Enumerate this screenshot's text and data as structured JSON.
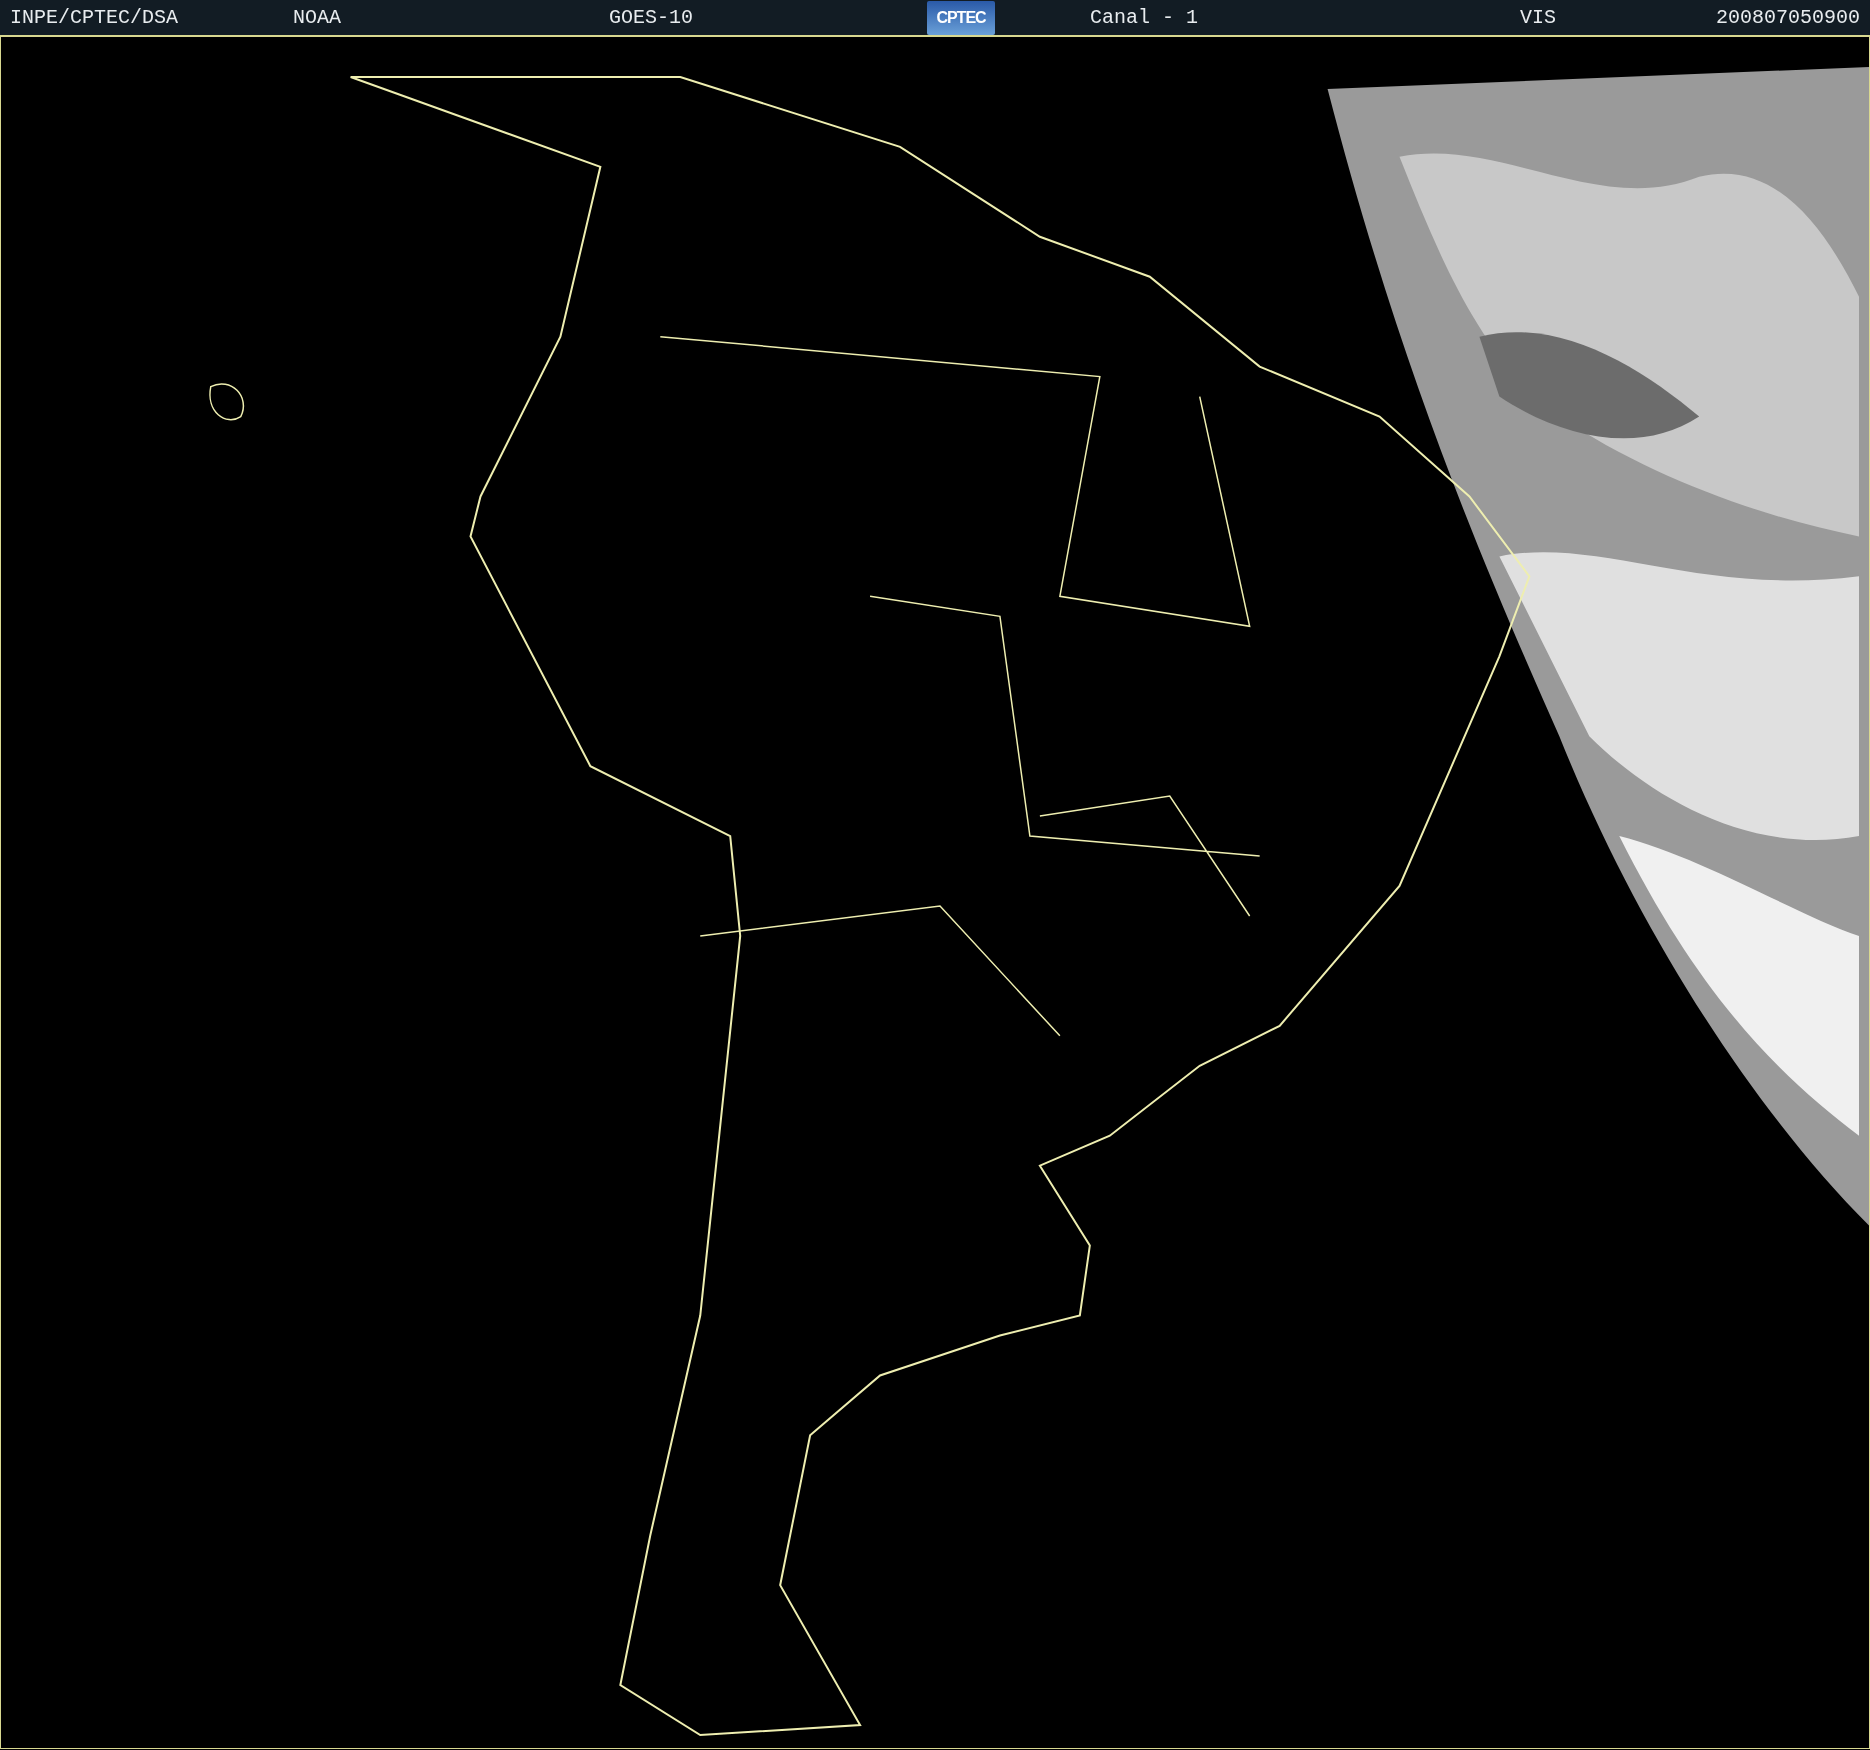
{
  "header": {
    "items": [
      {
        "kind": "text",
        "text": "INPE/CPTEC/DSA"
      },
      {
        "kind": "text",
        "text": "NOAA"
      },
      {
        "kind": "text",
        "text": "GOES-10"
      },
      {
        "kind": "logo",
        "text": "CPTEC"
      },
      {
        "kind": "text",
        "text": "Canal - 1"
      },
      {
        "kind": "text",
        "text": "VIS"
      },
      {
        "kind": "text",
        "text": "200807050900"
      }
    ]
  }
}
